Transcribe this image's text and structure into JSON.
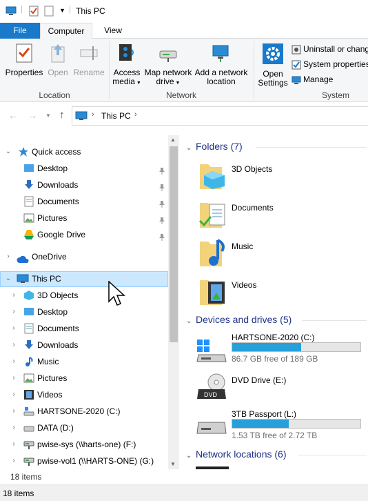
{
  "window": {
    "title": "This PC"
  },
  "tabs": {
    "file": "File",
    "computer": "Computer",
    "view": "View"
  },
  "ribbon": {
    "location": {
      "label": "Location",
      "properties": "Properties",
      "open": "Open",
      "rename": "Rename"
    },
    "network": {
      "label": "Network",
      "access_media_1": "Access",
      "access_media_2": "media",
      "map_drive_1": "Map network",
      "map_drive_2": "drive",
      "add_location_1": "Add a network",
      "add_location_2": "location"
    },
    "system": {
      "label": "System",
      "open_settings_1": "Open",
      "open_settings_2": "Settings",
      "uninstall": "Uninstall or change",
      "system_properties": "System properties",
      "manage": "Manage"
    }
  },
  "address": {
    "crumb": "This PC"
  },
  "nav": {
    "quick_access": "Quick access",
    "quick_items": [
      "Desktop",
      "Downloads",
      "Documents",
      "Pictures",
      "Google Drive"
    ],
    "onedrive": "OneDrive",
    "this_pc": "This PC",
    "pc_items": [
      "3D Objects",
      "Desktop",
      "Documents",
      "Downloads",
      "Music",
      "Pictures",
      "Videos",
      "HARTSONE-2020 (C:)",
      "DATA (D:)",
      "pwise-sys (\\\\harts-one) (F:)",
      "pwise-vol1 (\\\\HARTS-ONE) (G:)"
    ]
  },
  "content": {
    "folders_header": "Folders (7)",
    "folders": [
      "3D Objects",
      "Documents",
      "Music",
      "Videos"
    ],
    "devices_header": "Devices and drives (5)",
    "drives": [
      {
        "name": "HARTSONE-2020 (C:)",
        "free": "86.7 GB free of 189 GB",
        "used_fraction": 0.54
      },
      {
        "name": "DVD Drive (E:)",
        "dvd_label": "DVD"
      },
      {
        "name": "3TB Passport (L:)",
        "free": "1.53 TB free of 2.72 TB",
        "used_fraction": 0.44
      }
    ],
    "network_header": "Network locations (6)"
  },
  "nav_count": "18 items",
  "status": {
    "items": "18 items"
  },
  "colors": {
    "accent": "#1979ca",
    "selection": "#cce8ff",
    "drive_bar": "#26a0da",
    "section_header": "#1e3287"
  }
}
